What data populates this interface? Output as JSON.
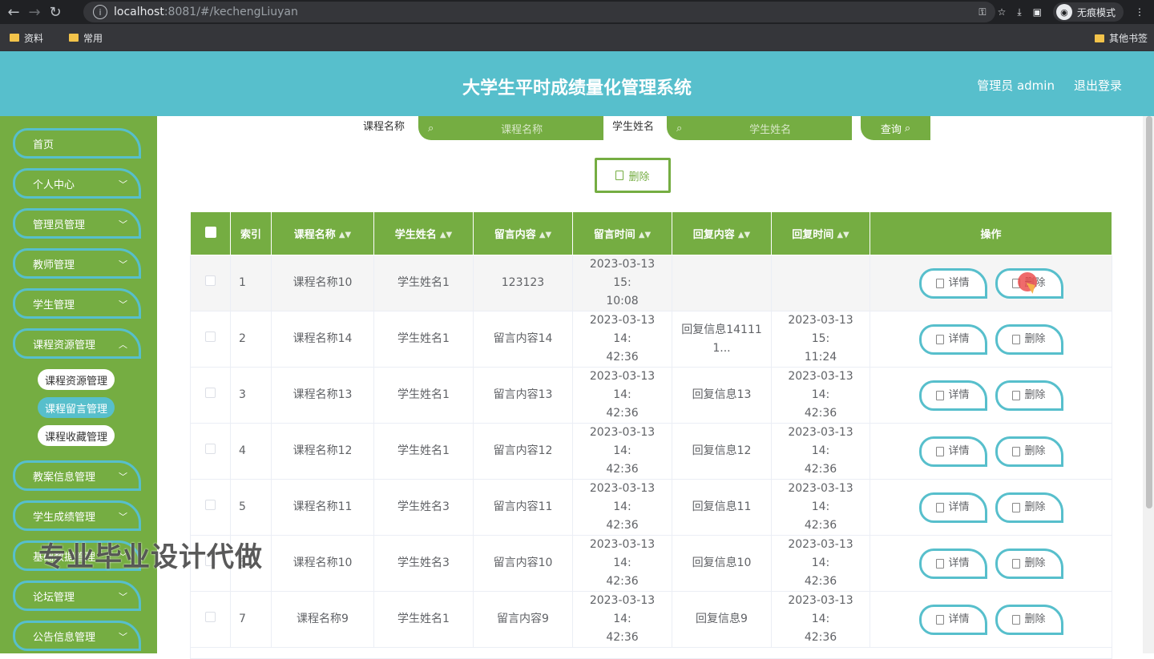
{
  "browser": {
    "url_host": "localhost",
    "url_path": ":8081/#/kechengLiuyan",
    "incognito_label": "无痕模式",
    "bookmarks": [
      "资料",
      "常用"
    ],
    "other_bookmarks": "其他书签"
  },
  "header": {
    "title": "大学生平时成绩量化管理系统",
    "user": "管理员 admin",
    "logout": "退出登录"
  },
  "sidebar": {
    "items": [
      {
        "label": "首页",
        "expandable": false
      },
      {
        "label": "个人中心",
        "expandable": true
      },
      {
        "label": "管理员管理",
        "expandable": true
      },
      {
        "label": "教师管理",
        "expandable": true
      },
      {
        "label": "学生管理",
        "expandable": true
      },
      {
        "label": "课程资源管理",
        "expandable": true
      },
      {
        "label": "教案信息管理",
        "expandable": true
      },
      {
        "label": "学生成绩管理",
        "expandable": true
      },
      {
        "label": "基础数据管理",
        "expandable": true
      },
      {
        "label": "论坛管理",
        "expandable": true
      },
      {
        "label": "公告信息管理",
        "expandable": true
      }
    ],
    "subitems": [
      {
        "label": "课程资源管理",
        "active": false
      },
      {
        "label": "课程留言管理",
        "active": true
      },
      {
        "label": "课程收藏管理",
        "active": false
      }
    ]
  },
  "search": {
    "course_label": "课程名称",
    "course_placeholder": "课程名称",
    "student_label": "学生姓名",
    "student_placeholder": "学生姓名",
    "button": "查询"
  },
  "toolbar": {
    "delete_label": "删除"
  },
  "table": {
    "headers": [
      "索引",
      "课程名称",
      "学生姓名",
      "留言内容",
      "留言时间",
      "回复内容",
      "回复时间",
      "操作"
    ],
    "detail_label": "详情",
    "delete_label": "删除",
    "rows": [
      {
        "index": "1",
        "course": "课程名称10",
        "student": "学生姓名1",
        "content": "123123",
        "time1": "2023-03-13 15:",
        "time2": "10:08",
        "reply1": "",
        "reply2": "",
        "rtime1": "",
        "rtime2": ""
      },
      {
        "index": "2",
        "course": "课程名称14",
        "student": "学生姓名1",
        "content": "留言内容14",
        "time1": "2023-03-13 14:",
        "time2": "42:36",
        "reply1": "回复信息14111",
        "reply2": "1...",
        "rtime1": "2023-03-13 15:",
        "rtime2": "11:24"
      },
      {
        "index": "3",
        "course": "课程名称13",
        "student": "学生姓名1",
        "content": "留言内容13",
        "time1": "2023-03-13 14:",
        "time2": "42:36",
        "reply1": "回复信息13",
        "reply2": "",
        "rtime1": "2023-03-13 14:",
        "rtime2": "42:36"
      },
      {
        "index": "4",
        "course": "课程名称12",
        "student": "学生姓名1",
        "content": "留言内容12",
        "time1": "2023-03-13 14:",
        "time2": "42:36",
        "reply1": "回复信息12",
        "reply2": "",
        "rtime1": "2023-03-13 14:",
        "rtime2": "42:36"
      },
      {
        "index": "5",
        "course": "课程名称11",
        "student": "学生姓名3",
        "content": "留言内容11",
        "time1": "2023-03-13 14:",
        "time2": "42:36",
        "reply1": "回复信息11",
        "reply2": "",
        "rtime1": "2023-03-13 14:",
        "rtime2": "42:36"
      },
      {
        "index": "6",
        "course": "课程名称10",
        "student": "学生姓名3",
        "content": "留言内容10",
        "time1": "2023-03-13 14:",
        "time2": "42:36",
        "reply1": "回复信息10",
        "reply2": "",
        "rtime1": "2023-03-13 14:",
        "rtime2": "42:36"
      },
      {
        "index": "7",
        "course": "课程名称9",
        "student": "学生姓名1",
        "content": "留言内容9",
        "time1": "2023-03-13 14:",
        "time2": "42:36",
        "reply1": "回复信息9",
        "reply2": "",
        "rtime1": "2023-03-13 14:",
        "rtime2": "42:36"
      }
    ]
  },
  "watermark": "专业毕业设计代做",
  "colors": {
    "accent": "#57bfcc",
    "green": "#75ad42"
  }
}
